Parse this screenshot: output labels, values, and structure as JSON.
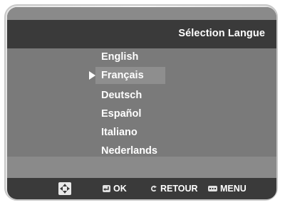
{
  "header": {
    "title": "Sélection Langue"
  },
  "languages": [
    {
      "label": "English"
    },
    {
      "label": "Français"
    },
    {
      "label": "Deutsch"
    },
    {
      "label": "Español"
    },
    {
      "label": "Italiano"
    },
    {
      "label": "Nederlands"
    }
  ],
  "selected_index": 1,
  "footer": {
    "nav_icon": "directional-pad-icon",
    "ok": {
      "icon": "enter-icon",
      "label": "OK"
    },
    "back": {
      "icon": "return-arrow-icon",
      "label": "RETOUR"
    },
    "menu": {
      "icon": "menu-icon",
      "label": "MENU"
    }
  },
  "colors": {
    "header_bg": "#3a3a3a",
    "body_bg": "#7a7a7a",
    "selected_bg": "#8e8e8e",
    "text": "#ffffff"
  }
}
